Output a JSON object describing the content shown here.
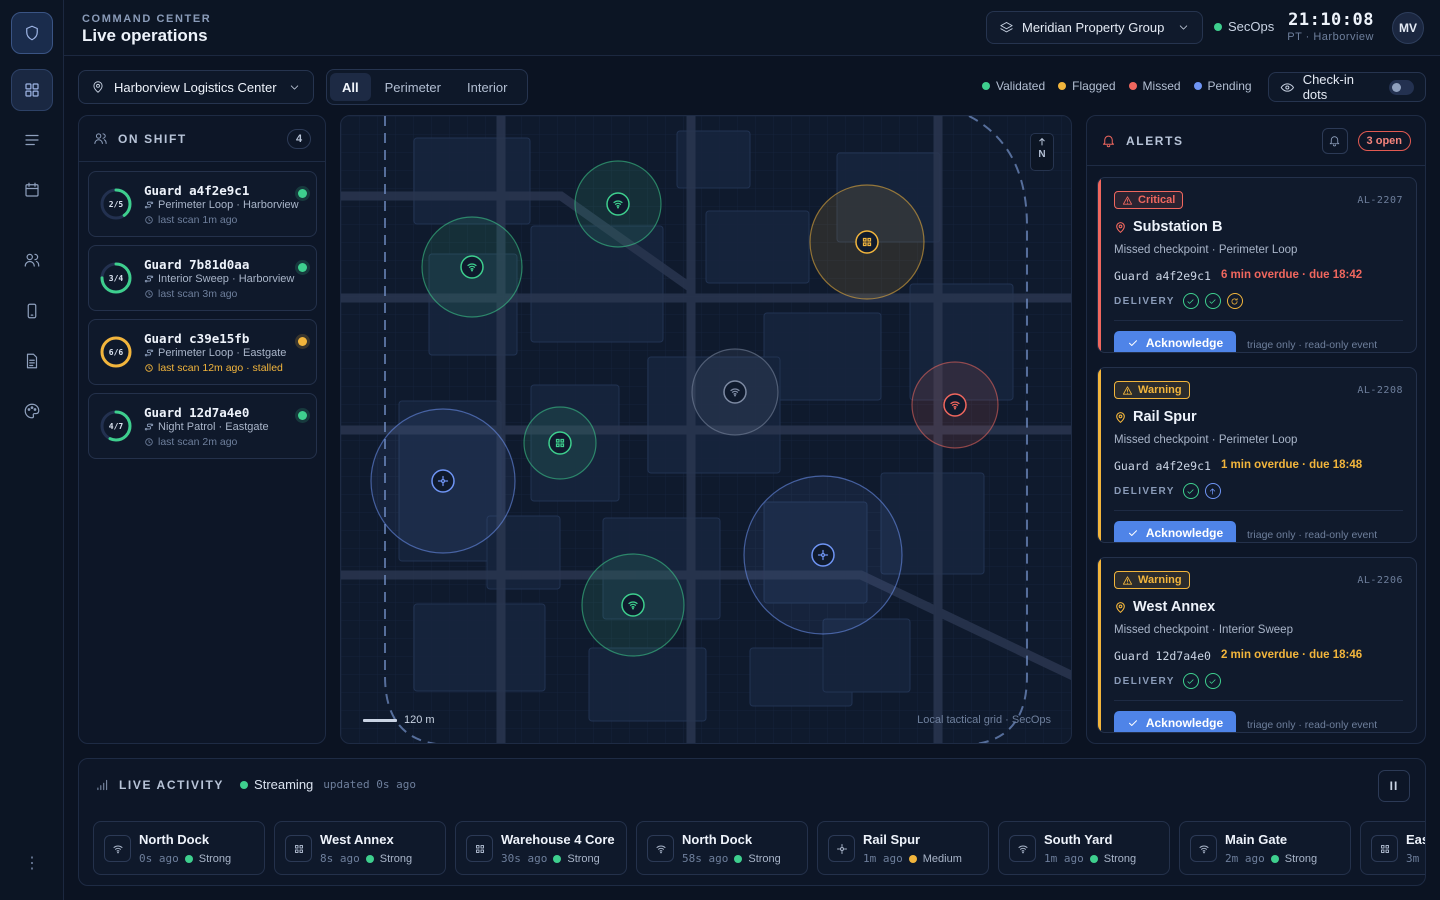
{
  "header": {
    "eyebrow": "COMMAND CENTER",
    "title": "Live operations",
    "org": "Meridian Property Group",
    "team": "SecOps",
    "time": "21:10:08",
    "zone": "PT · Harborview",
    "avatar": "MV"
  },
  "rail": {
    "icons": [
      "shield-logo",
      "dashboard-grid",
      "list",
      "calendar",
      "users",
      "mobile-device",
      "document",
      "palette"
    ],
    "more": "⋮"
  },
  "toolbar": {
    "site": "Harborview Logistics Center",
    "tabs": [
      "All",
      "Perimeter",
      "Interior"
    ],
    "active_tab": "All",
    "legend": [
      {
        "label": "Validated",
        "color": "#3ecf8e"
      },
      {
        "label": "Flagged",
        "color": "#f2b53c"
      },
      {
        "label": "Missed",
        "color": "#f0675e"
      },
      {
        "label": "Pending",
        "color": "#6f95f5"
      }
    ],
    "checkin_toggle": "Check-in dots",
    "checkin_on": false
  },
  "shift": {
    "title": "ON SHIFT",
    "count": "4",
    "guards": [
      {
        "name": "Guard a4f2e9c1",
        "progress": "2/5",
        "progress_frac": 0.4,
        "ring": "#3ecf8e",
        "route": "Perimeter Loop · Harborview",
        "scan": "last scan 1m ago",
        "status": "g",
        "warn": false
      },
      {
        "name": "Guard 7b81d0aa",
        "progress": "3/4",
        "progress_frac": 0.75,
        "ring": "#3ecf8e",
        "route": "Interior Sweep · Harborview",
        "scan": "last scan 3m ago",
        "status": "g",
        "warn": false
      },
      {
        "name": "Guard c39e15fb",
        "progress": "6/6",
        "progress_frac": 1.0,
        "ring": "#f2b53c",
        "route": "Perimeter Loop · Eastgate",
        "scan": "last scan 12m ago · stalled",
        "status": "y",
        "warn": true
      },
      {
        "name": "Guard 12d7a4e0",
        "progress": "4/7",
        "progress_frac": 0.57,
        "ring": "#3ecf8e",
        "route": "Night Patrol · Eastgate",
        "scan": "last scan 2m ago",
        "status": "g",
        "warn": false
      }
    ]
  },
  "map": {
    "north": "N",
    "scale": "120 m",
    "note": "Local tactical grid · SecOps",
    "checkpoints": [
      {
        "name": "wifi-checkpoint",
        "status": "validated"
      },
      {
        "name": "wifi-checkpoint",
        "status": "validated"
      },
      {
        "name": "qr-checkpoint",
        "status": "flagged"
      },
      {
        "name": "wifi-checkpoint",
        "status": "neutral"
      },
      {
        "name": "wifi-checkpoint",
        "status": "missed"
      },
      {
        "name": "qr-checkpoint",
        "status": "validated"
      },
      {
        "name": "beacon-checkpoint",
        "status": "pending"
      },
      {
        "name": "beacon-checkpoint",
        "status": "pending"
      },
      {
        "name": "wifi-checkpoint",
        "status": "validated"
      }
    ]
  },
  "alerts": {
    "title": "ALERTS",
    "open": "3 open",
    "items": [
      {
        "severity": "Critical",
        "id": "AL-2207",
        "location": "Substation B",
        "detail": "Missed checkpoint · Perimeter Loop",
        "guard": "Guard a4f2e9c1",
        "overdue": "6 min overdue · due 18:42",
        "delivery_label": "DELIVERY",
        "delivery": [
          "sent",
          "sent",
          "retry"
        ],
        "action": "Acknowledge",
        "note": "triage only · read-only event",
        "accent": "#f0675e"
      },
      {
        "severity": "Warning",
        "id": "AL-2208",
        "location": "Rail Spur",
        "detail": "Missed checkpoint · Perimeter Loop",
        "guard": "Guard a4f2e9c1",
        "overdue": "1 min overdue · due 18:48",
        "delivery_label": "DELIVERY",
        "delivery": [
          "sent",
          "pending"
        ],
        "action": "Acknowledge",
        "note": "triage only · read-only event",
        "accent": "#f2b53c"
      },
      {
        "severity": "Warning",
        "id": "AL-2206",
        "location": "West Annex",
        "detail": "Missed checkpoint · Interior Sweep",
        "guard": "Guard 12d7a4e0",
        "overdue": "2 min overdue · due 18:46",
        "delivery_label": "DELIVERY",
        "delivery": [
          "sent",
          "sent"
        ],
        "action": "Acknowledge",
        "note": "triage only · read-only event",
        "accent": "#f2b53c"
      }
    ]
  },
  "activity": {
    "title": "LIVE ACTIVITY",
    "status": "Streaming",
    "updated": "updated 0s ago",
    "pause": "II",
    "items": [
      {
        "name": "North Dock",
        "ago": "0s ago",
        "signal": "Strong",
        "icon": "wifi",
        "color": "#3ecf8e"
      },
      {
        "name": "West Annex",
        "ago": "8s ago",
        "signal": "Strong",
        "icon": "qr",
        "color": "#3ecf8e"
      },
      {
        "name": "Warehouse 4 Core",
        "ago": "30s ago",
        "signal": "Strong",
        "icon": "qr",
        "color": "#3ecf8e"
      },
      {
        "name": "North Dock",
        "ago": "58s ago",
        "signal": "Strong",
        "icon": "wifi",
        "color": "#3ecf8e"
      },
      {
        "name": "Rail Spur",
        "ago": "1m ago",
        "signal": "Medium",
        "icon": "beacon",
        "color": "#f2b53c"
      },
      {
        "name": "South Yard",
        "ago": "1m ago",
        "signal": "Strong",
        "icon": "wifi",
        "color": "#3ecf8e"
      },
      {
        "name": "Main Gate",
        "ago": "2m ago",
        "signal": "Strong",
        "icon": "wifi",
        "color": "#3ecf8e"
      },
      {
        "name": "Eas",
        "ago": "3m",
        "signal": "",
        "icon": "qr",
        "color": "#3ecf8e"
      }
    ]
  }
}
